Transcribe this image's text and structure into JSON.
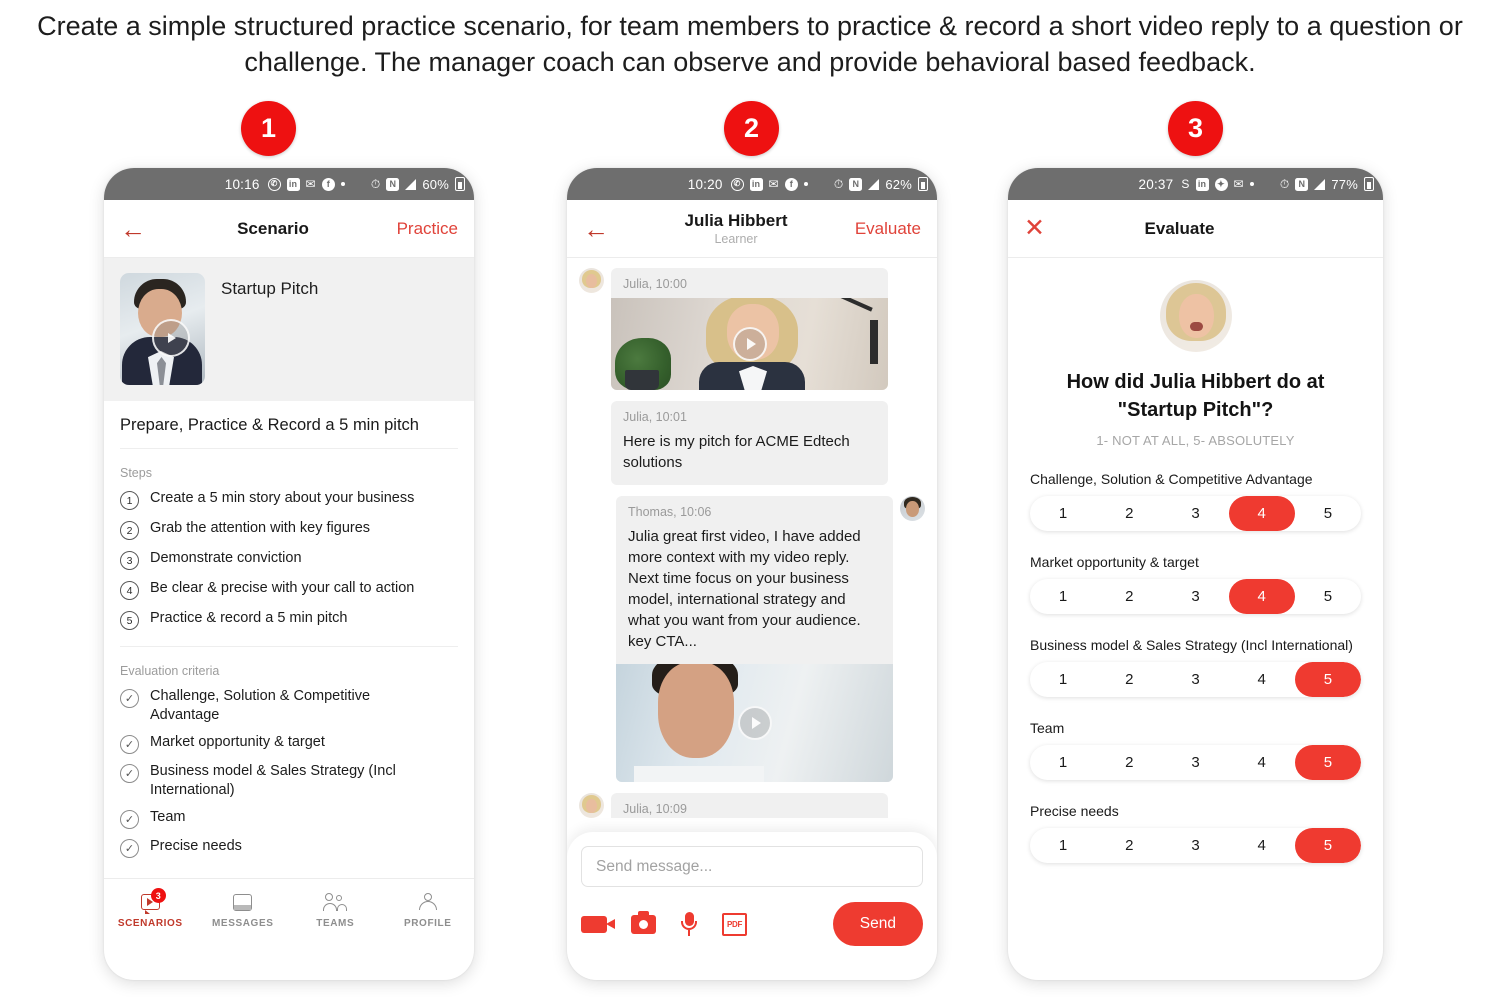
{
  "caption": "Create a simple structured practice scenario, for team members to practice & record a short video reply to a question or challenge. The manager coach can observe and provide behavioral based feedback.",
  "badges": [
    {
      "number": "1"
    },
    {
      "number": "2"
    },
    {
      "number": "3"
    }
  ],
  "accent_color": "#ee1111",
  "phone1": {
    "status_bar": {
      "time": "10:16",
      "battery": "60%",
      "icons": [
        "whatsapp-icon",
        "linkedin-icon",
        "gmail-icon",
        "facebook-icon",
        "dot-icon",
        "alarm-icon",
        "nfc-icon",
        "signal-icon",
        "battery-icon"
      ]
    },
    "nav": {
      "back": "←",
      "title": "Scenario",
      "action": "Practice"
    },
    "scenario": {
      "title": "Startup Pitch"
    },
    "task": "Prepare, Practice & Record a 5 min pitch",
    "steps_label": "Steps",
    "steps": [
      {
        "num": "1",
        "text": "Create a 5 min story about your business"
      },
      {
        "num": "2",
        "text": "Grab the attention with key figures"
      },
      {
        "num": "3",
        "text": "Demonstrate conviction"
      },
      {
        "num": "4",
        "text": "Be clear & precise with your call to action"
      },
      {
        "num": "5",
        "text": "Practice & record a 5 min pitch"
      }
    ],
    "criteria_label": "Evaluation criteria",
    "criteria": [
      "Challenge, Solution & Competitive Advantage",
      "Market opportunity & target",
      "Business model & Sales Strategy (Incl International)",
      "Team",
      "Precise needs"
    ],
    "tabs": [
      {
        "label": "SCENARIOS",
        "badge": "3",
        "active": true
      },
      {
        "label": "MESSAGES",
        "badge": "",
        "active": false
      },
      {
        "label": "TEAMS",
        "badge": "",
        "active": false
      },
      {
        "label": "PROFILE",
        "badge": "",
        "active": false
      }
    ]
  },
  "phone2": {
    "status_bar": {
      "time": "10:20",
      "battery": "62%"
    },
    "nav": {
      "back": "←",
      "title": "Julia Hibbert",
      "subtitle": "Learner",
      "action": "Evaluate"
    },
    "messages": [
      {
        "meta": "Julia, 10:00",
        "text": "",
        "has_video": true,
        "sender": "julia"
      },
      {
        "meta": "Julia, 10:01",
        "text": "Here is my pitch for ACME Edtech solutions",
        "has_video": false,
        "sender": "julia"
      },
      {
        "meta": "Thomas, 10:06",
        "text": "Julia great first video, I have added more context with my video reply. Next time focus on your business model, international strategy and what you want from your audience. key CTA...",
        "has_video": true,
        "sender": "thomas"
      },
      {
        "meta": "Julia, 10:09",
        "text": "",
        "has_video": false,
        "sender": "julia"
      }
    ],
    "composer": {
      "placeholder": "Send message...",
      "value": "",
      "send_label": "Send",
      "actions": [
        "video-icon",
        "camera-icon",
        "microphone-icon",
        "pdf-icon"
      ]
    }
  },
  "phone3": {
    "status_bar": {
      "time": "20:37",
      "battery": "77%"
    },
    "nav": {
      "close": "✕",
      "title": "Evaluate"
    },
    "question": "How did Julia Hibbert do at \"Startup Pitch\"?",
    "scale_hint": "1- NOT AT ALL, 5- ABSOLUTELY",
    "ratings": [
      {
        "label": "Challenge, Solution & Competitive Advantage",
        "options": [
          "1",
          "2",
          "3",
          "4",
          "5"
        ],
        "selected": 4
      },
      {
        "label": "Market opportunity & target",
        "options": [
          "1",
          "2",
          "3",
          "4",
          "5"
        ],
        "selected": 4
      },
      {
        "label": "Business model & Sales Strategy (Incl International)",
        "options": [
          "1",
          "2",
          "3",
          "4",
          "5"
        ],
        "selected": 5
      },
      {
        "label": "Team",
        "options": [
          "1",
          "2",
          "3",
          "4",
          "5"
        ],
        "selected": 5
      },
      {
        "label": "Precise needs",
        "options": [
          "1",
          "2",
          "3",
          "4",
          "5"
        ],
        "selected": 5
      }
    ]
  }
}
